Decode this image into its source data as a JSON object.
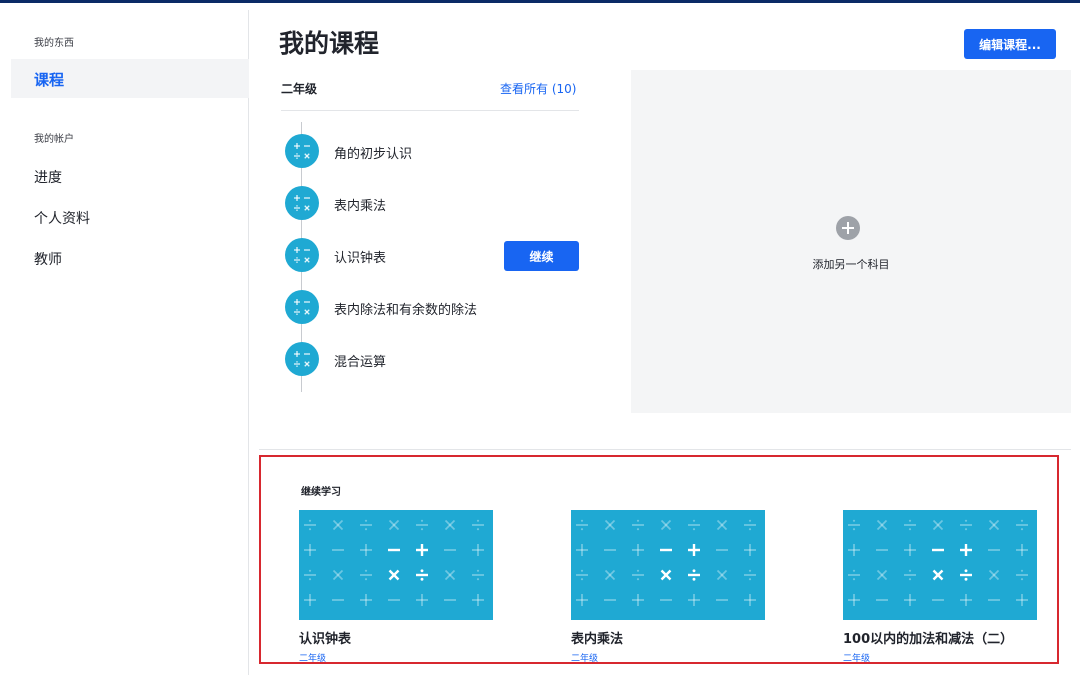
{
  "sidebar": {
    "section1_header": "我的东西",
    "active_item": "课程",
    "section2_header": "我的帐户",
    "items": [
      "进度",
      "个人资料",
      "教师"
    ]
  },
  "main": {
    "title": "我的课程",
    "edit_label": "编辑课程...",
    "course": {
      "grade": "二年级",
      "view_all": "查看所有 (10)",
      "units": [
        "角的初步认识",
        "表内乘法",
        "认识钟表",
        "表内除法和有余数的除法",
        "混合运算"
      ],
      "continue_label": "继续"
    },
    "add_subject_label": "添加另一个科目"
  },
  "continue_learning": {
    "title": "继续学习",
    "cards": [
      {
        "title": "认识钟表",
        "subtitle": "二年级"
      },
      {
        "title": "表内乘法",
        "subtitle": "二年级"
      },
      {
        "title": "100以内的加法和减法（二）",
        "subtitle": "二年级"
      }
    ]
  },
  "colors": {
    "accent": "#1865f2",
    "math_teal": "#1fa9d3",
    "highlight_border": "#d7282f"
  }
}
